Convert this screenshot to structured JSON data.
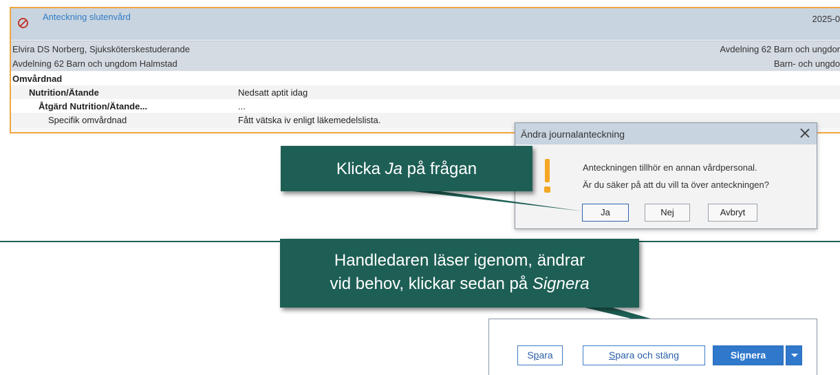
{
  "note": {
    "title": "Anteckning slutenvård",
    "date": "2025-0",
    "author": "Elvira DS Norberg, Sjuksköterskestuderande",
    "unit_right": "Avdelning 62 Barn och ungdor",
    "unit_left": "Avdelning 62 Barn och ungdom Halmstad",
    "dept_right": "Barn- och ungdo",
    "section": "Omvårdnad",
    "rows": [
      {
        "key": "Nutrition/Ätande",
        "value": "Nedsatt aptit idag"
      },
      {
        "key": "Åtgärd Nutrition/Ätande...",
        "value": "..."
      },
      {
        "key": "Specifik omvårdnad",
        "value": "Fått vätska iv enligt läkemedelslista."
      }
    ]
  },
  "dialog": {
    "title": "Ändra journalanteckning",
    "message_line1": "Anteckningen tillhör en annan vårdpersonal.",
    "message_line2": "Är du säker på att du vill ta över anteckningen?",
    "yes_label": "Ja",
    "no_label": "Nej",
    "cancel_label": "Avbryt"
  },
  "callouts": {
    "first": {
      "before": "Klicka ",
      "emph": "Ja",
      "after": " på frågan"
    },
    "second": {
      "line1": "Handledaren läser igenom, ändrar",
      "line2_before": "vid behov, klickar sedan på ",
      "line2_emph": "Signera"
    }
  },
  "toolbar": {
    "save_first": "S",
    "save_underlined": "p",
    "save_rest": "ara",
    "save_close_underlined": "S",
    "save_close_rest": "para och stäng",
    "sign_label": "Signera"
  },
  "colors": {
    "callout_bg": "#1e5f55",
    "note_border": "#f0a640",
    "header_bg": "#c9d4e1",
    "primary_button": "#2f78cc",
    "warning": "#f5a623"
  },
  "icons": [
    "no-entry-icon",
    "close-icon",
    "warning-icon",
    "chevron-down-icon"
  ]
}
